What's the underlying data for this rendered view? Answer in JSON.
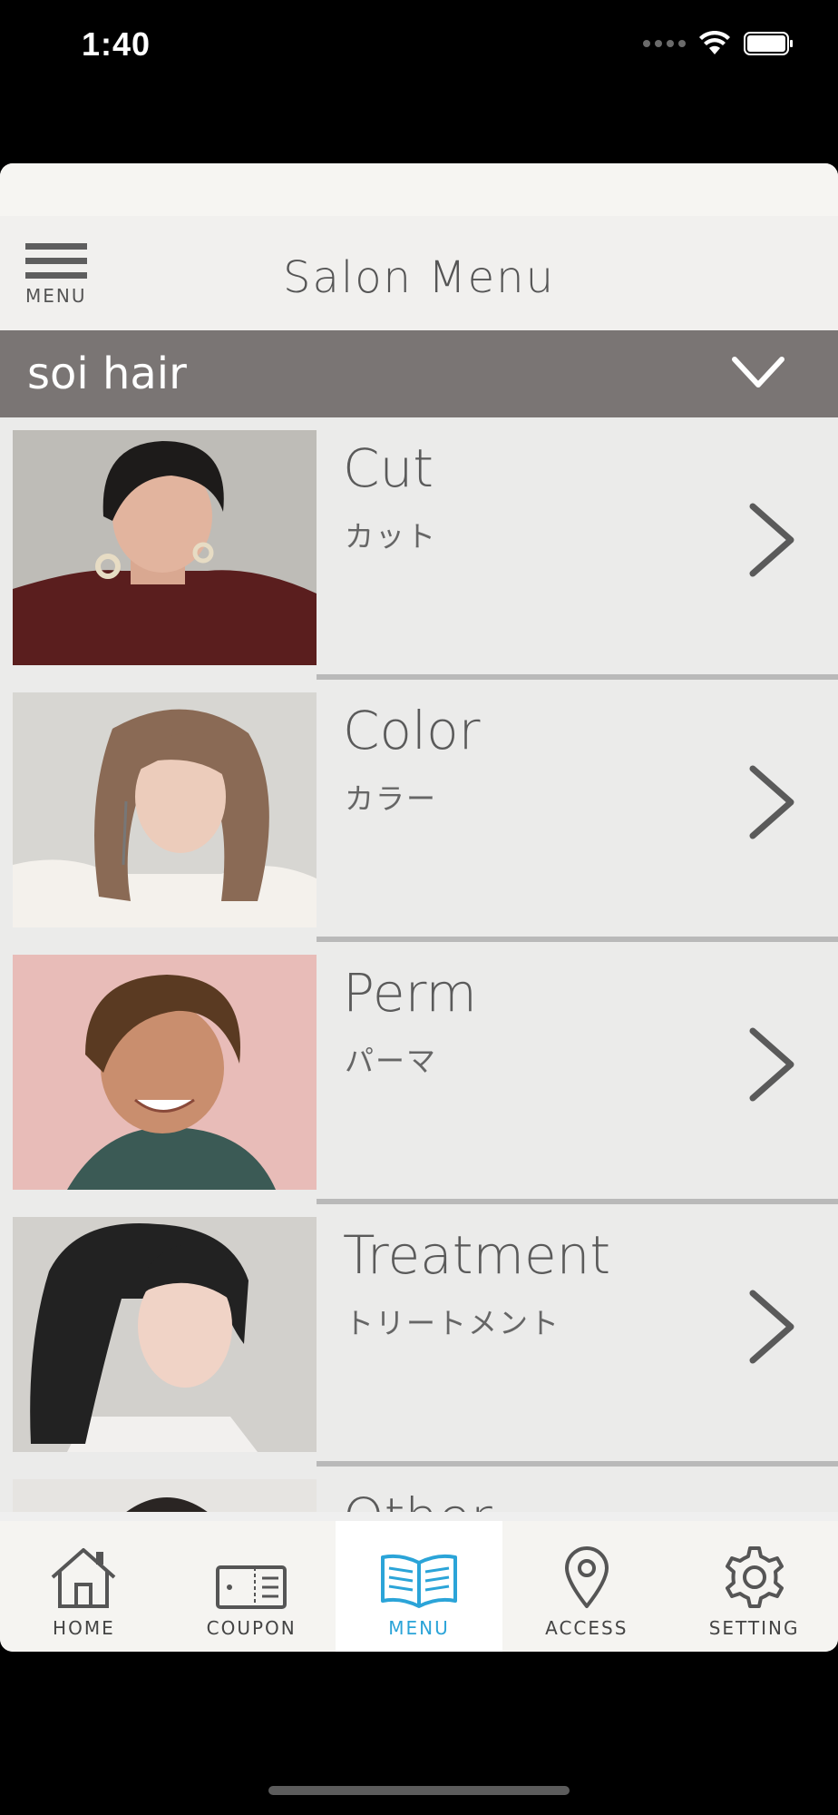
{
  "status_bar": {
    "time": "1:40"
  },
  "header": {
    "menu_label": "MENU",
    "title": "Salon Menu"
  },
  "salon_selector": {
    "selected": "soi hair"
  },
  "menu_items": [
    {
      "en": "Cut",
      "jp": "カット"
    },
    {
      "en": "Color",
      "jp": "カラー"
    },
    {
      "en": "Perm",
      "jp": "パーマ"
    },
    {
      "en": "Treatment",
      "jp": "トリートメント"
    },
    {
      "en": "Other",
      "jp": ""
    }
  ],
  "tabs": [
    {
      "label": "HOME",
      "icon": "home-icon"
    },
    {
      "label": "COUPON",
      "icon": "coupon-icon"
    },
    {
      "label": "MENU",
      "icon": "book-icon",
      "active": true
    },
    {
      "label": "ACCESS",
      "icon": "map-pin-icon"
    },
    {
      "label": "SETTING",
      "icon": "gear-icon"
    }
  ],
  "colors": {
    "accent": "#2ba4d8",
    "selector_bg": "#7a7574",
    "divider": "#b9b9b9"
  }
}
